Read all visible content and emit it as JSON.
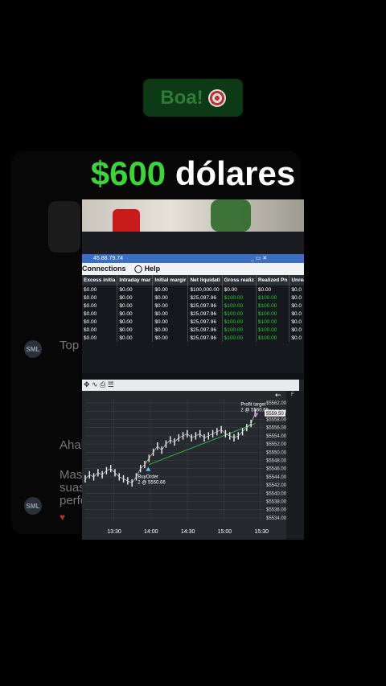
{
  "story": {
    "badge_text": "Boa!",
    "badge_icon": "target-emoji-icon",
    "headline_amount": "$600",
    "headline_word": "dólares",
    "colors": {
      "amount": "#3cd43a",
      "badge_bg": "#0b3a14"
    }
  },
  "background_chat": {
    "messages": [
      "Top",
      "Ahah",
      "Mas",
      "suas",
      "perfo"
    ],
    "avatar": "SML"
  },
  "photo": {
    "window_title": "45.88.79.74",
    "menu": {
      "connections": "Connections",
      "help": "Help"
    },
    "table": {
      "headers": [
        "Excess initia",
        "Intraday mar",
        "Initial margir",
        "Net liquidati",
        "Gross realiz",
        "Realized Pn",
        "Unrealiz"
      ],
      "rows": [
        [
          "$0.00",
          "$0.00",
          "$0.00",
          "$100,000.00",
          "$0.00",
          "$0.00",
          "$0.0"
        ],
        [
          "$0.00",
          "$0.00",
          "$0.00",
          "$25,097.96",
          "$100.00",
          "$100.00",
          "$0.0"
        ],
        [
          "$0.00",
          "$0.00",
          "$0.00",
          "$25,097.96",
          "$100.00",
          "$100.00",
          "$0.0"
        ],
        [
          "$0.00",
          "$0.00",
          "$0.00",
          "$25,097.96",
          "$100.00",
          "$100.00",
          "$0.0"
        ],
        [
          "$0.00",
          "$0.00",
          "$0.00",
          "$25,097.96",
          "$100.00",
          "$100.00",
          "$0.0"
        ],
        [
          "$0.00",
          "$0.00",
          "$0.00",
          "$25,097.96",
          "$100.00",
          "$100.00",
          "$0.0"
        ],
        [
          "$0.00",
          "$0.00",
          "$0.00",
          "$25,097.96",
          "$100.00",
          "$100.00",
          "$0.0"
        ]
      ]
    },
    "chart": {
      "buy_label": "BuyOrder",
      "buy_detail": "2 @ 5550.66",
      "target_label": "Profit target",
      "target_detail": "2 @ 5560.66",
      "last_price": "5559.50",
      "right_col_label": "F"
    }
  },
  "chart_data": {
    "type": "line",
    "title": "",
    "x_ticks": [
      "13:30",
      "14:00",
      "14:30",
      "15:00",
      "15:30"
    ],
    "y_ticks": [
      5562.0,
      5560.0,
      5558.0,
      5556.0,
      5554.0,
      5552.0,
      5550.0,
      5548.0,
      5546.0,
      5544.0,
      5542.0,
      5540.0,
      5538.0,
      5536.0,
      5534.0
    ],
    "ylim": [
      5533,
      5563
    ],
    "x": [
      0,
      3,
      6,
      9,
      12,
      15,
      18,
      21,
      24,
      27,
      30,
      33,
      36,
      39,
      42,
      45,
      48,
      51,
      54,
      57,
      60,
      63,
      66,
      69,
      72,
      75,
      78,
      81,
      84,
      87,
      90,
      93,
      96,
      99,
      102,
      105,
      108,
      111,
      114,
      117,
      120
    ],
    "series": [
      {
        "values": [
          5543.5,
          5544.5,
          5544,
          5545,
          5544.5,
          5545.5,
          5546,
          5545,
          5544,
          5543.5,
          5543,
          5542.5,
          5544,
          5546,
          5547,
          5548.5,
          5550,
          5551.5,
          5550.5,
          5552,
          5553,
          5552.5,
          5553.5,
          5554,
          5554.5,
          5553.5,
          5554,
          5554.5,
          5553.5,
          5554,
          5554.5,
          5555,
          5555.5,
          5554.5,
          5554,
          5553.5,
          5554,
          5555,
          5556,
          5557,
          5559.5
        ]
      }
    ],
    "trend_from": [
      45,
      5547
    ],
    "trend_to": [
      120,
      5557
    ],
    "grid": true
  }
}
